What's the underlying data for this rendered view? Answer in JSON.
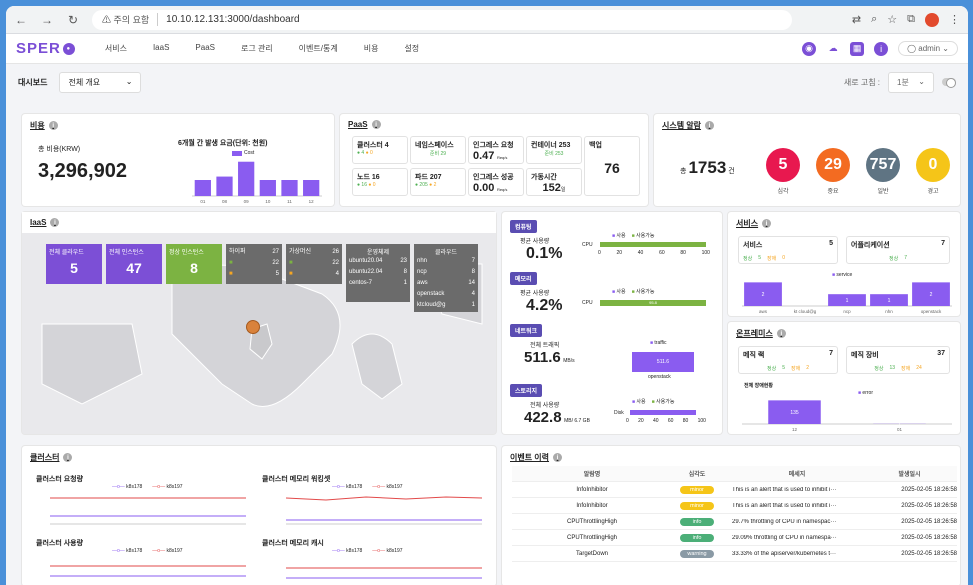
{
  "browser": {
    "warning": "주의 요함",
    "url": "10.10.12.131:3000/dashboard"
  },
  "nav": {
    "logo": "SPER",
    "menu": [
      "서비스",
      "IaaS",
      "PaaS",
      "로그 관리",
      "이벤트/통계",
      "비용",
      "설정"
    ],
    "user": "admin"
  },
  "toolbar": {
    "label": "대시보드",
    "select_value": "전체 개요",
    "refresh_label": "새로 고침 :",
    "refresh_value": "1분"
  },
  "cost": {
    "title": "비용",
    "total_label": "총 비용(KRW)",
    "total_value": "3,296,902",
    "chart_title": "6개월 간 발생 요금(단위: 천원)",
    "legend": "Cost"
  },
  "chart_data": [
    {
      "type": "bar",
      "title": "6개월 간 발생 요금(단위: 천원)",
      "categories": [
        "01",
        "08",
        "09",
        "10",
        "11",
        "12"
      ],
      "series": [
        {
          "name": "Cost",
          "values": [
            14,
            17,
            30,
            14,
            14,
            14
          ]
        }
      ],
      "ylim": [
        0,
        35
      ]
    },
    {
      "type": "bar",
      "title": "",
      "categories": [
        "aws",
        "kt cloud@g",
        "ncp",
        "nhn",
        "openstack"
      ],
      "series": [
        {
          "name": "service",
          "values": [
            2,
            0,
            1,
            1,
            2
          ]
        }
      ]
    },
    {
      "type": "bar",
      "title": "",
      "categories": [
        "12",
        "01"
      ],
      "series": [
        {
          "name": "error",
          "values": [
            135,
            1
          ]
        }
      ]
    }
  ],
  "paas": {
    "title": "PaaS",
    "boxes": [
      {
        "label": "클러스터 4",
        "sub_ok": "4",
        "sub_warn": "0"
      },
      {
        "label": "네임스페이스",
        "sub": "준비 29"
      },
      {
        "label": "인그레스 요청",
        "value": "0.47",
        "unit": "Req/s"
      },
      {
        "label": "컨테이너 253",
        "sub": "준비 253"
      },
      {
        "label": "노드 16",
        "sub_ok": "16",
        "sub_warn": "0"
      },
      {
        "label": "파드 207",
        "sub_ok": "205",
        "sub_warn": "2"
      },
      {
        "label": "인그레스 성공",
        "value": "0.00",
        "unit": "Req/s"
      },
      {
        "label": "가동시간",
        "value": "152",
        "unit": "일"
      }
    ],
    "backup_label": "백업",
    "backup_value": "76"
  },
  "alerts": {
    "title": "시스템 알람",
    "total_prefix": "총",
    "total_value": "1753",
    "total_unit": "건",
    "items": [
      {
        "value": "5",
        "label": "심각",
        "color": "#e8184f"
      },
      {
        "value": "29",
        "label": "중요",
        "color": "#f36b21"
      },
      {
        "value": "757",
        "label": "일반",
        "color": "#5f7483"
      },
      {
        "value": "0",
        "label": "경고",
        "color": "#f5c518"
      }
    ]
  },
  "iaas": {
    "title": "IaaS",
    "tiles": [
      {
        "label": "전체 클라우드",
        "value": "5",
        "color": "#7c4fd6"
      },
      {
        "label": "전체 인스턴스",
        "value": "47",
        "color": "#7c4fd6"
      },
      {
        "label": "정상 인스턴스",
        "value": "8",
        "color": "#7cb342"
      }
    ],
    "vm_tiles": [
      {
        "label": "하이퍼",
        "value": "27",
        "r1": "22",
        "r2": "5"
      },
      {
        "label": "가상머신",
        "value": "26",
        "r1": "22",
        "r2": "4"
      }
    ],
    "os": {
      "label": "운영체제",
      "items": [
        {
          "n": "ubuntu20.04",
          "v": "23"
        },
        {
          "n": "ubuntu22.04",
          "v": "8"
        },
        {
          "n": "centos-7",
          "v": "1"
        }
      ]
    },
    "clouds": {
      "label": "클라우드",
      "items": [
        {
          "n": "nhn",
          "v": "7"
        },
        {
          "n": "ncp",
          "v": "8"
        },
        {
          "n": "aws",
          "v": "14"
        },
        {
          "n": "openstack",
          "v": "4"
        },
        {
          "n": "ktcloud@g",
          "v": "1"
        }
      ]
    }
  },
  "compute": {
    "title": "컴퓨팅",
    "label": "평균 사용량",
    "value": "0.1%",
    "bar_label": "CPU",
    "legend": [
      "사용",
      "사용가능"
    ],
    "ticks": [
      "0",
      "20",
      "40",
      "60",
      "80",
      "100"
    ]
  },
  "memory": {
    "title": "메모리",
    "label": "평균 사용량",
    "value": "4.2%",
    "bar_label": "CPU",
    "bar_value": "95.8",
    "legend": [
      "사용",
      "사용가능"
    ]
  },
  "network": {
    "title": "네트워크",
    "label": "전체 트래픽",
    "value": "511.6",
    "unit": "MB/s",
    "legend": "traffic",
    "bar_value": "511.6",
    "bar_label": "openstack"
  },
  "storage": {
    "title": "스토리지",
    "label": "전체 사용량",
    "value": "422.8",
    "unit": "MB/ 6.7 GB",
    "legend": [
      "사용",
      "사용가능"
    ],
    "bar_label": "Disk",
    "ticks": [
      "0",
      "20",
      "40",
      "60",
      "80",
      "100"
    ]
  },
  "services": {
    "title": "서비스",
    "box1": {
      "label": "서비스",
      "value": "5",
      "ok_label": "정상",
      "ok": "5",
      "warn_label": "장애",
      "warn": "0"
    },
    "box2": {
      "label": "어플리케이션",
      "value": "7",
      "ok_label": "정상",
      "ok": "7"
    },
    "legend": "service"
  },
  "onprem": {
    "title": "온프레미스",
    "box1": {
      "label": "메직 랙",
      "value": "7",
      "ok_label": "정상",
      "ok": "5",
      "warn_label": "장애",
      "warn": "2"
    },
    "box2": {
      "label": "메직 장비",
      "value": "37",
      "ok_label": "정상",
      "ok": "13",
      "warn_label": "장애",
      "warn": "24"
    },
    "chart_title": "전체 장애현황",
    "legend": "error"
  },
  "clusters": {
    "title": "클러스터",
    "charts": [
      {
        "title": "클러스터 요청량",
        "legend": [
          "k8s178",
          "k8s197"
        ]
      },
      {
        "title": "클러스터 메모리 워킹셋",
        "legend": [
          "k8s178",
          "k8s197"
        ]
      },
      {
        "title": "클러스터 사용량",
        "legend": [
          "k8s178",
          "k8s197"
        ]
      },
      {
        "title": "클러스터 메모리 캐시",
        "legend": [
          "k8s178",
          "k8s197"
        ]
      }
    ]
  },
  "events": {
    "title": "이벤트 이력",
    "headers": [
      "알람명",
      "심각도",
      "메세지",
      "발생일시"
    ],
    "rows": [
      {
        "name": "InfoInhibitor",
        "sev": "minor",
        "sev_color": "#f5c518",
        "msg": "This is an alert that is used to inhibit i···",
        "time": "2025-02-05 18:26:58"
      },
      {
        "name": "InfoInhibitor",
        "sev": "minor",
        "sev_color": "#f5c518",
        "msg": "This is an alert that is used to inhibit i···",
        "time": "2025-02-05 18:26:58"
      },
      {
        "name": "CPUThrottlingHigh",
        "sev": "info",
        "sev_color": "#4caf78",
        "msg": "29.7% throttling of CPU in namespac···",
        "time": "2025-02-05 18:26:58"
      },
      {
        "name": "CPUThrottlingHigh",
        "sev": "info",
        "sev_color": "#4caf78",
        "msg": "29.09% throttling of CPU in namespa···",
        "time": "2025-02-05 18:26:58"
      },
      {
        "name": "TargetDown",
        "sev": "warning",
        "sev_color": "#8a9aa5",
        "msg": "33.33% of the apiserver/kubernetes t···",
        "time": "2025-02-05 18:26:58"
      }
    ]
  }
}
